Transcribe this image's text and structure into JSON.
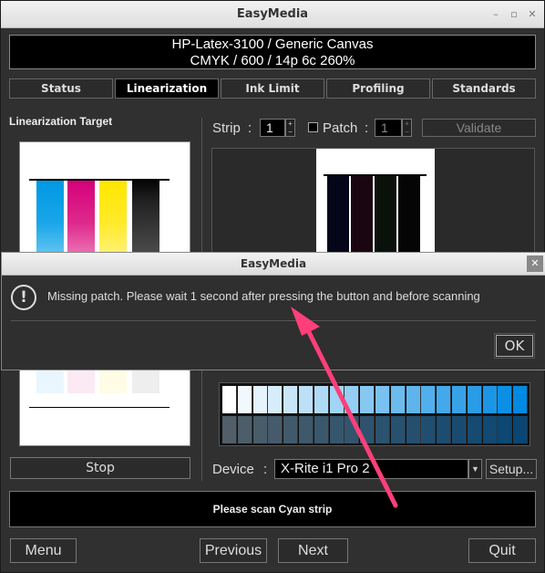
{
  "window": {
    "title": "EasyMedia"
  },
  "header": {
    "line1": "HP-Latex-3100 / Generic Canvas",
    "line2": "CMYK / 600 / 14p 6c 260%"
  },
  "tabs": [
    {
      "label": "Status"
    },
    {
      "label": "Linearization"
    },
    {
      "label": "Ink Limit"
    },
    {
      "label": "Profiling"
    },
    {
      "label": "Standards"
    }
  ],
  "left": {
    "title": "Linearization Target",
    "stop_label": "Stop"
  },
  "toolbar": {
    "strip_label": "Strip",
    "colon": ":",
    "strip_value": "1",
    "patch_label": "Patch",
    "patch_value": "1",
    "validate_label": "Validate"
  },
  "device": {
    "label": "Device",
    "colon": ":",
    "selected": "X-Rite i1 Pro 2",
    "setup_label": "Setup..."
  },
  "status": {
    "message": "Please scan Cyan strip"
  },
  "buttons": {
    "menu": "Menu",
    "previous": "Previous",
    "next": "Next",
    "quit": "Quit"
  },
  "dialog": {
    "title": "EasyMedia",
    "message": "Missing patch. Please wait 1 second after pressing the button and before scanning",
    "ok_label": "OK"
  },
  "colors": {
    "cyan": "#0096e0",
    "magenta": "#d6007a",
    "yellow": "#ffe600",
    "black": "#111111",
    "annotation_arrow": "#ff3f7a"
  }
}
